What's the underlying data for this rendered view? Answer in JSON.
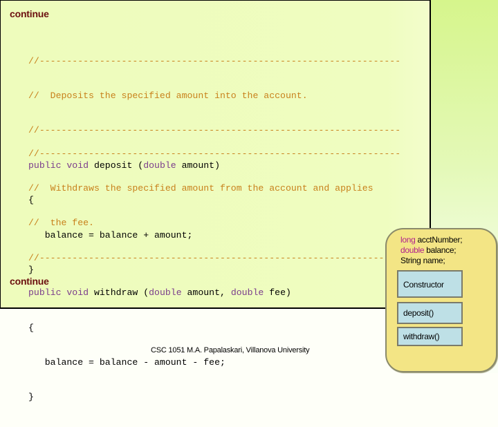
{
  "slide": {
    "continue_top": "continue",
    "continue_bottom": "continue",
    "footer": "CSC 1051 M.A. Papalaskari, Villanova University"
  },
  "code": {
    "deposit": {
      "comment_rule": "//------------------------------------------------------------------",
      "comment_lines": [
        "//  Deposits the specified amount into the account."
      ],
      "modifiers": "public void",
      "name": " deposit (",
      "param_type": "double",
      "params_rest": " amount)",
      "open_brace": "{",
      "body": "   balance = balance + amount;",
      "close_brace": "}"
    },
    "withdraw": {
      "comment_rule": "//------------------------------------------------------------------",
      "comment_lines": [
        "//  Withdraws the specified amount from the account and applies",
        "//  the fee."
      ],
      "modifiers": "public void",
      "name": " withdraw (",
      "param_type": "double",
      "param1": " amount, ",
      "param_type2": "double",
      "params_rest": " fee)",
      "open_brace": "{",
      "body": "   balance = balance - amount - fee;",
      "close_brace": "}"
    }
  },
  "class_diagram": {
    "fields": [
      {
        "type": "long",
        "name": " acctNumber;"
      },
      {
        "type": "double",
        "name": " balance;"
      },
      {
        "type": "",
        "name": "String name;"
      }
    ],
    "methods": [
      "Constructor",
      "deposit()",
      "withdraw()"
    ]
  },
  "colors": {
    "comment": "#c8811c",
    "keyword": "#7a3c8c",
    "continue": "#6b0f0f",
    "code_bg": "#effdc0",
    "panel_bg": "#f3e585",
    "method_bg": "#bee0e6",
    "field_type": "#b0208c"
  }
}
